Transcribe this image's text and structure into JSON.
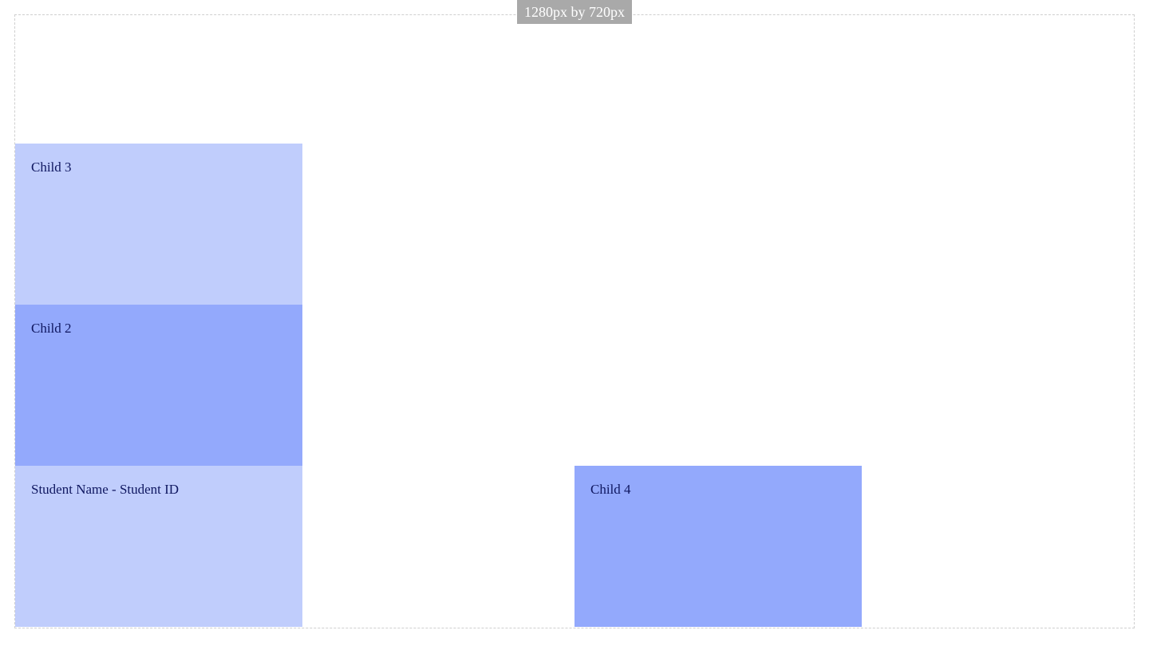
{
  "viewport_label": "1280px by 720px",
  "boxes": {
    "child3": "Child 3",
    "child2": "Child 2",
    "student": "Student Name - Student ID",
    "child4": "Child 4"
  },
  "colors": {
    "light_box": "#c0cdfc",
    "mid_box": "#93a9fc",
    "label_bg": "#a9a9a9",
    "text": "#0f1760"
  }
}
